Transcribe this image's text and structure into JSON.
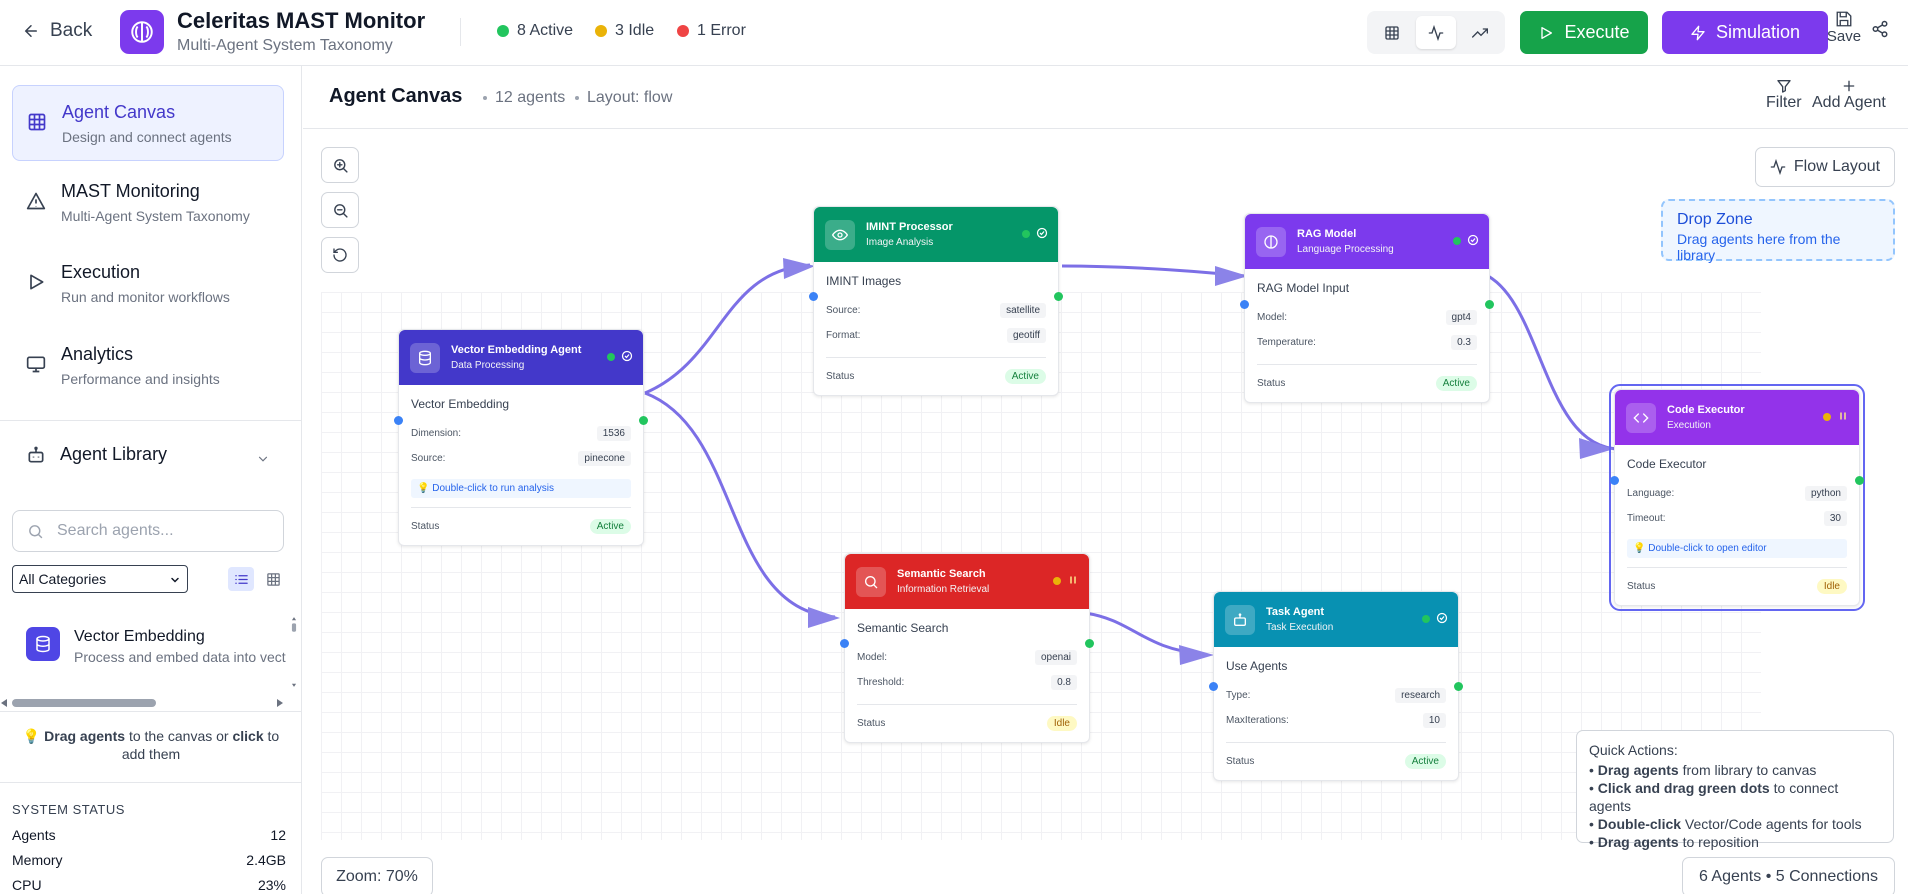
{
  "header": {
    "back_label": "Back",
    "title": "Celeritas MAST Monitor",
    "subtitle": "Multi-Agent System Taxonomy",
    "stats": [
      {
        "label": "8 Active",
        "color": "#22c55e"
      },
      {
        "label": "3 Idle",
        "color": "#eab308"
      },
      {
        "label": "1 Error",
        "color": "#ef4444"
      }
    ],
    "view_icons": [
      "grid-icon",
      "activity-icon",
      "trending-icon"
    ],
    "execute_label": "Execute",
    "simulation_label": "Simulation",
    "save_label": "Save"
  },
  "sidebar": {
    "nav": [
      {
        "label": "Agent Canvas",
        "desc": "Design and connect agents",
        "icon": "grid-icon",
        "active": true
      },
      {
        "label": "MAST Monitoring",
        "desc": "Multi-Agent System Taxonomy",
        "icon": "alert-triangle-icon"
      },
      {
        "label": "Execution",
        "desc": "Run and monitor workflows",
        "icon": "play-icon"
      },
      {
        "label": "Analytics",
        "desc": "Performance and insights",
        "icon": "monitor-icon"
      }
    ],
    "library": {
      "title": "Agent Library",
      "search_placeholder": "Search agents...",
      "category": "All Categories",
      "items": [
        {
          "title": "Vector Embedding",
          "desc": "Process and embed data into vect",
          "icon": "database-icon"
        }
      ],
      "hint_bold1": "Drag agents",
      "hint_mid": " to the canvas or ",
      "hint_bold2": "click",
      "hint_end": " to add them"
    },
    "system_status": {
      "title": "SYSTEM STATUS",
      "rows": [
        {
          "label": "Agents",
          "value": "12"
        },
        {
          "label": "Memory",
          "value": "2.4GB"
        },
        {
          "label": "CPU",
          "value": "23%"
        }
      ]
    }
  },
  "canvas_header": {
    "title": "Agent Canvas",
    "agent_count": "12 agents",
    "layout": "Layout: flow",
    "filter_label": "Filter",
    "add_label": "Add Agent"
  },
  "canvas": {
    "zoom_level": "Zoom: 70%",
    "flow_layout_label": "Flow Layout",
    "drop_zone": {
      "title": "Drop Zone",
      "desc": "Drag agents here from the library"
    },
    "quick_actions": {
      "title": "Quick Actions:",
      "items": [
        {
          "bold": "Drag agents",
          "rest": " from library to canvas"
        },
        {
          "bold": "Click and drag green dots",
          "rest": " to connect agents"
        },
        {
          "bold": "Double-click",
          "rest": " Vector/Code agents for tools"
        },
        {
          "bold": "Drag agents",
          "rest": " to reposition"
        }
      ]
    },
    "summary": "6 Agents • 5 Connections",
    "agents": [
      {
        "id": "vector",
        "title": "Vector Embedding Agent",
        "sub": "Data Processing",
        "color": "#4338ca",
        "icon": "database-icon",
        "dot": "#22c55e",
        "state_icon": "check-circle-icon",
        "body_title": "Vector Embedding",
        "fields": [
          {
            "k": "Dimension:",
            "v": "1536"
          },
          {
            "k": "Source:",
            "v": "pinecone"
          }
        ],
        "tip": "💡 Double-click to run analysis",
        "status_label": "Status",
        "status": "Active"
      },
      {
        "id": "imint",
        "title": "IMINT Processor",
        "sub": "Image Analysis",
        "color": "#059669",
        "icon": "eye-icon",
        "dot": "#22c55e",
        "state_icon": "check-circle-icon",
        "body_title": "IMINT Images",
        "fields": [
          {
            "k": "Source:",
            "v": "satellite"
          },
          {
            "k": "Format:",
            "v": "geotiff"
          }
        ],
        "status_label": "Status",
        "status": "Active"
      },
      {
        "id": "rag",
        "title": "RAG Model",
        "sub": "Language Processing",
        "color": "#7c3aed",
        "icon": "brain-icon",
        "dot": "#22c55e",
        "state_icon": "check-circle-icon",
        "body_title": "RAG Model Input",
        "fields": [
          {
            "k": "Model:",
            "v": "gpt4"
          },
          {
            "k": "Temperature:",
            "v": "0.3"
          }
        ],
        "status_label": "Status",
        "status": "Active"
      },
      {
        "id": "semantic",
        "title": "Semantic Search",
        "sub": "Information Retrieval",
        "color": "#dc2626",
        "icon": "search-icon",
        "dot": "#eab308",
        "state_icon": "pause-icon",
        "body_title": "Semantic Search",
        "fields": [
          {
            "k": "Model:",
            "v": "openai"
          },
          {
            "k": "Threshold:",
            "v": "0.8"
          }
        ],
        "status_label": "Status",
        "status": "Idle"
      },
      {
        "id": "task",
        "title": "Task Agent",
        "sub": "Task Execution",
        "color": "#0891b2",
        "icon": "bot-icon",
        "dot": "#22c55e",
        "state_icon": "check-circle-icon",
        "body_title": "Use Agents",
        "fields": [
          {
            "k": "Type:",
            "v": "research"
          },
          {
            "k": "MaxIterations:",
            "v": "10"
          }
        ],
        "status_label": "Status",
        "status": "Active"
      },
      {
        "id": "code",
        "title": "Code Executor",
        "sub": "Execution",
        "color": "#9333ea",
        "icon": "code-icon",
        "dot": "#eab308",
        "state_icon": "pause-icon",
        "body_title": "Code Executor",
        "fields": [
          {
            "k": "Language:",
            "v": "python"
          },
          {
            "k": "Timeout:",
            "v": "30"
          }
        ],
        "tip": "💡 Double-click to open editor",
        "status_label": "Status",
        "status": "Idle"
      }
    ]
  }
}
